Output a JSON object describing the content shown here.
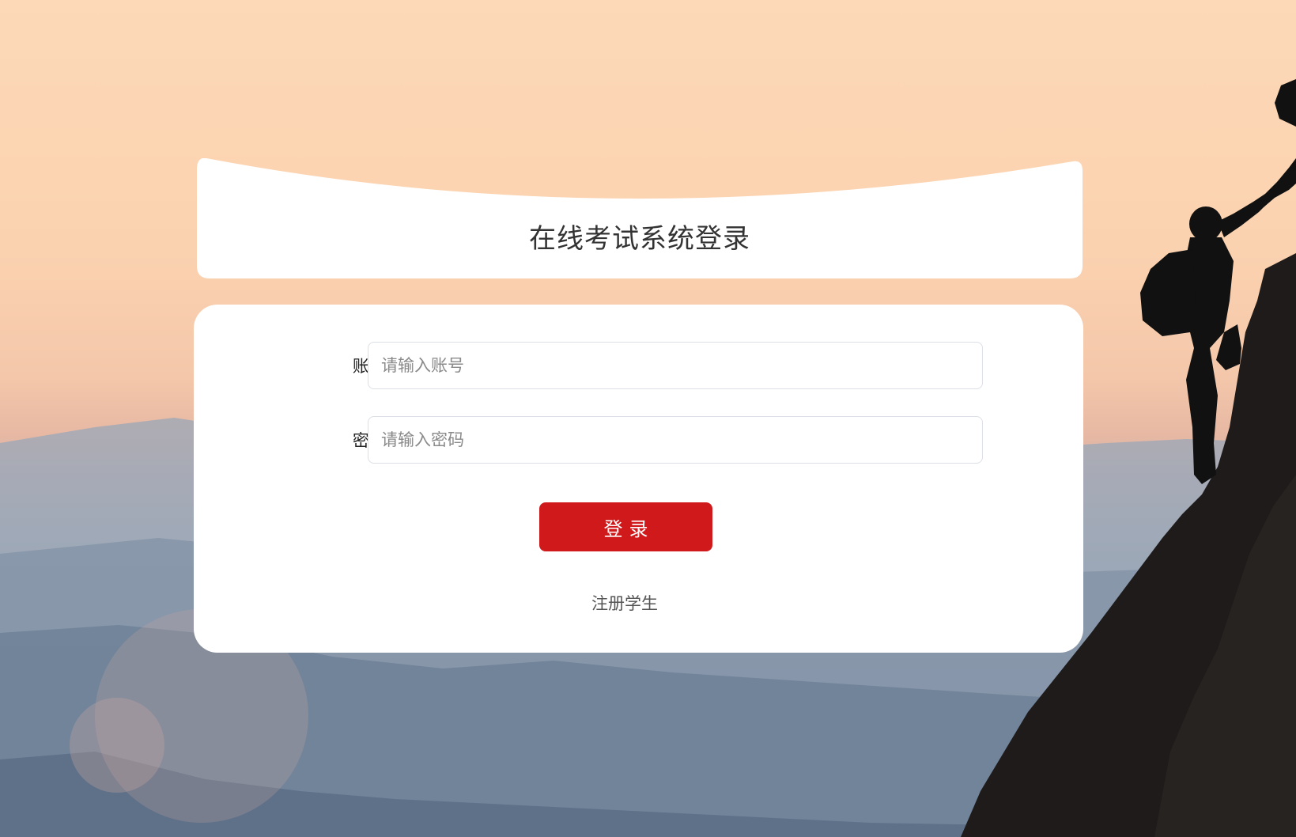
{
  "header": {
    "title": "在线考试系统登录"
  },
  "form": {
    "account_label": "账号:",
    "account_placeholder": "请输入账号",
    "account_value": "",
    "password_label": "密码:",
    "password_placeholder": "请输入密码",
    "password_value": "",
    "login_label": "登录",
    "register_label": "注册学生"
  },
  "colors": {
    "primary_button": "#d0191b",
    "card_background": "#ffffff"
  },
  "background": {
    "description_icon": "mountain-climbers-image"
  }
}
